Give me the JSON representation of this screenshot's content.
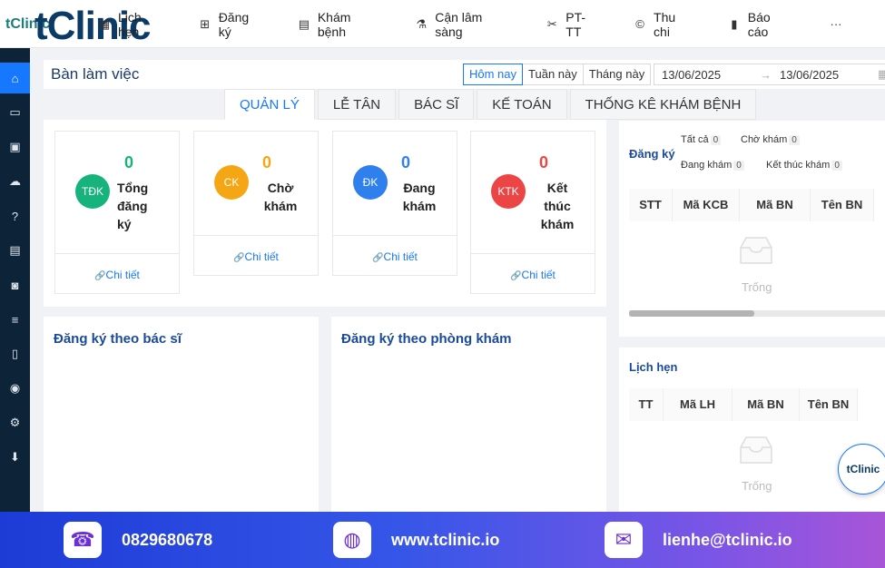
{
  "logo": {
    "small": "tClinic",
    "big": "tClinic"
  },
  "nav": [
    {
      "icon": "calendar-icon",
      "glyph": "▦",
      "label": "Lịch hẹn"
    },
    {
      "icon": "plus-square-icon",
      "glyph": "⊞",
      "label": "Đăng ký"
    },
    {
      "icon": "clipboard-icon",
      "glyph": "▤",
      "label": "Khám bệnh"
    },
    {
      "icon": "flask-icon",
      "glyph": "⚗",
      "label": "Cận lâm sàng"
    },
    {
      "icon": "scissors-icon",
      "glyph": "✂",
      "label": "PT-TT"
    },
    {
      "icon": "currency-icon",
      "glyph": "©",
      "label": "Thu chi"
    },
    {
      "icon": "bar-chart-icon",
      "glyph": "▮",
      "label": "Báo cáo"
    },
    {
      "icon": "more-icon",
      "glyph": "···",
      "label": ""
    }
  ],
  "sidebar": [
    {
      "icon": "home-icon",
      "glyph": "⌂",
      "active": true
    },
    {
      "icon": "id-card-icon",
      "glyph": "▭",
      "active": false
    },
    {
      "icon": "archive-icon",
      "glyph": "▣",
      "active": false
    },
    {
      "icon": "cloud-upload-icon",
      "glyph": "☁",
      "active": false
    },
    {
      "icon": "question-icon",
      "glyph": "?",
      "active": false
    },
    {
      "icon": "list-card-icon",
      "glyph": "▤",
      "active": false
    },
    {
      "icon": "money-icon",
      "glyph": "◙",
      "active": false
    },
    {
      "icon": "list-icon",
      "glyph": "≡",
      "active": false
    },
    {
      "icon": "document-icon",
      "glyph": "▯",
      "active": false
    },
    {
      "icon": "user-circle-icon",
      "glyph": "◉",
      "active": false
    },
    {
      "icon": "settings-icon",
      "glyph": "⚙",
      "active": false
    },
    {
      "icon": "download-icon",
      "glyph": "⬇",
      "active": false
    }
  ],
  "header": {
    "title": "Bàn làm việc",
    "date_tabs": [
      "Hôm nay",
      "Tuần này",
      "Tháng này"
    ],
    "active_date_tab": 0,
    "date_from": "13/06/2025",
    "date_to": "13/06/2025",
    "arrow": "→"
  },
  "tabs": [
    {
      "label": "QUẢN LÝ",
      "active": true
    },
    {
      "label": "LỄ TÂN",
      "active": false
    },
    {
      "label": "BÁC SĨ",
      "active": false
    },
    {
      "label": "KẾ TOÁN",
      "active": false
    },
    {
      "label": "THỐNG KÊ KHÁM BỆNH",
      "active": false
    }
  ],
  "stats": [
    {
      "abbr": "TĐK",
      "value": "0",
      "label": "Tổng đăng ký",
      "color": "#16b37c",
      "num_color": "#16b37c",
      "link": "Chi tiết"
    },
    {
      "abbr": "CK",
      "value": "0",
      "label": "Chờ khám",
      "color": "#f5a614",
      "num_color": "#f5a614",
      "link": "Chi tiết"
    },
    {
      "abbr": "ĐK",
      "value": "0",
      "label": "Đang khám",
      "color": "#2f80ed",
      "num_color": "#2f80ed",
      "link": "Chi tiết"
    },
    {
      "abbr": "KTK",
      "value": "0",
      "label": "Kết thúc khám",
      "color": "#eb4545",
      "num_color": "#eb4545",
      "link": "Chi tiết"
    }
  ],
  "panels": {
    "by_doctor": "Đăng ký theo bác sĩ",
    "by_room": "Đăng ký theo phòng khám"
  },
  "registrations": {
    "title": "Đăng ký",
    "filters": [
      {
        "label": "Tất cả",
        "count": "0"
      },
      {
        "label": "Chờ khám",
        "count": "0"
      },
      {
        "label": "Đang khám",
        "count": "0"
      },
      {
        "label": "Kết thúc khám",
        "count": "0"
      }
    ],
    "columns": [
      "STT",
      "Mã KCB",
      "Mã BN",
      "Tên BN"
    ],
    "empty": "Trống"
  },
  "appointments": {
    "title": "Lịch hẹn",
    "columns": [
      "TT",
      "Mã LH",
      "Mã BN",
      "Tên BN"
    ],
    "empty": "Trống"
  },
  "fab_label": "tClinic",
  "footer": {
    "phone": "0829680678",
    "website": "www.tclinic.io",
    "email": "lienhe@tclinic.io"
  }
}
